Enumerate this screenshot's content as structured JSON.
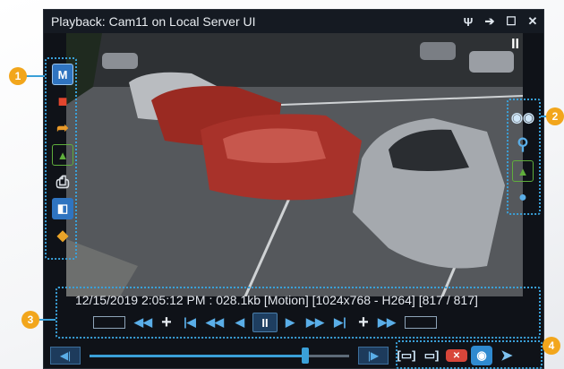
{
  "window": {
    "title": "Playback: Cam11 on Local Server UI",
    "controls": [
      "pin-icon",
      "detach-icon",
      "maximize-icon",
      "close-icon"
    ]
  },
  "video": {
    "pause_overlay": "II"
  },
  "left_toolbar": [
    {
      "name": "motion-icon",
      "glyph": "M",
      "color": "#2f74c0"
    },
    {
      "name": "record-icon",
      "glyph": "■",
      "color": "#e2462e"
    },
    {
      "name": "export-icon",
      "glyph": "➦",
      "color": "#e89a2a"
    },
    {
      "name": "snapshot-icon",
      "glyph": "▲",
      "color": "#5fae3c"
    },
    {
      "name": "print-icon",
      "glyph": "⎙",
      "color": "#d8dde3"
    },
    {
      "name": "layout-icon",
      "glyph": "◧",
      "color": "#2f74c0"
    },
    {
      "name": "bookmark-tag-icon",
      "glyph": "◆",
      "color": "#e8a329"
    }
  ],
  "right_toolbar": [
    {
      "name": "binoculars-icon",
      "glyph": "👀",
      "color": "#7ec2f0"
    },
    {
      "name": "search-icon",
      "glyph": "⚲",
      "color": "#5aaee8"
    },
    {
      "name": "image-icon",
      "glyph": "▲",
      "color": "#5fae3c"
    },
    {
      "name": "microphone-icon",
      "glyph": "🎙",
      "color": "#5aaee8"
    }
  ],
  "info": {
    "text": "12/15/2019 2:05:12 PM : 028.1kb [Motion] [1024x768 - H264] [817 / 817]"
  },
  "transport": {
    "rewind": "◀◀",
    "plus": "+",
    "first": "|◀",
    "fast_back": "◀◀",
    "step_back": "◀",
    "pause": "II",
    "step_fwd": "▶",
    "fast_fwd": "▶▶",
    "last": "▶|",
    "forward": "▶▶"
  },
  "bottom": {
    "prev": "◀|",
    "next": "|▶",
    "slider_value": 0.83
  },
  "callouts": [
    "1",
    "2",
    "3",
    "4"
  ]
}
